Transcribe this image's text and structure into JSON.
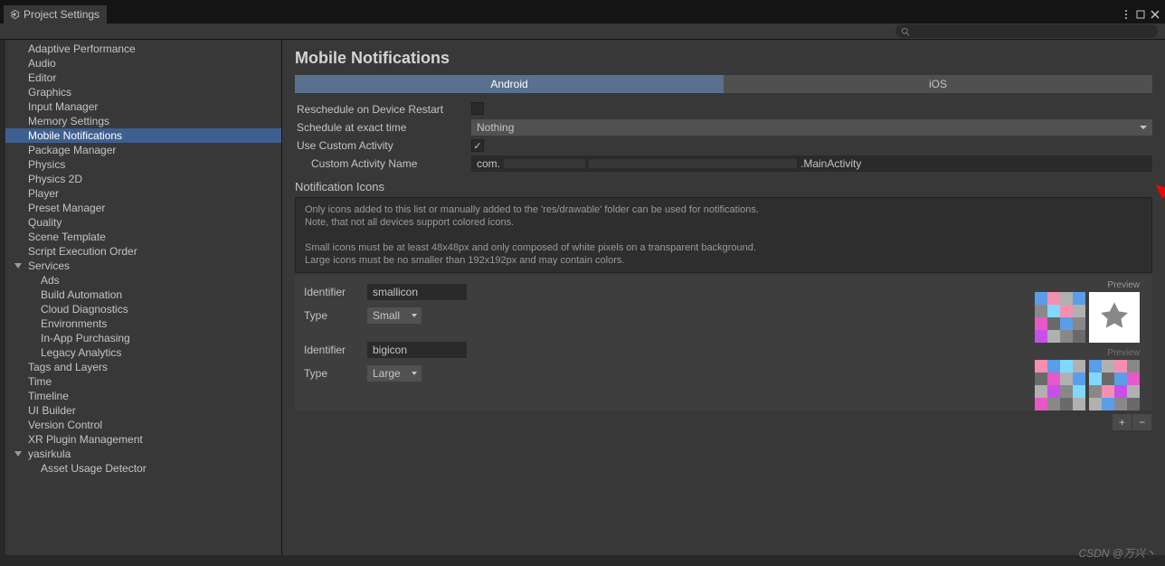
{
  "window": {
    "tab_title": "Project Settings"
  },
  "sidebar": {
    "items": [
      {
        "label": "Adaptive Performance"
      },
      {
        "label": "Audio"
      },
      {
        "label": "Editor"
      },
      {
        "label": "Graphics"
      },
      {
        "label": "Input Manager"
      },
      {
        "label": "Memory Settings"
      },
      {
        "label": "Mobile Notifications",
        "selected": true
      },
      {
        "label": "Package Manager"
      },
      {
        "label": "Physics"
      },
      {
        "label": "Physics 2D"
      },
      {
        "label": "Player"
      },
      {
        "label": "Preset Manager"
      },
      {
        "label": "Quality"
      },
      {
        "label": "Scene Template"
      },
      {
        "label": "Script Execution Order"
      },
      {
        "label": "Services",
        "expandable": true,
        "expanded": true
      },
      {
        "label": "Ads",
        "indent": 1
      },
      {
        "label": "Build Automation",
        "indent": 1
      },
      {
        "label": "Cloud Diagnostics",
        "indent": 1
      },
      {
        "label": "Environments",
        "indent": 1
      },
      {
        "label": "In-App Purchasing",
        "indent": 1
      },
      {
        "label": "Legacy Analytics",
        "indent": 1
      },
      {
        "label": "Tags and Layers"
      },
      {
        "label": "Time"
      },
      {
        "label": "Timeline"
      },
      {
        "label": "UI Builder"
      },
      {
        "label": "Version Control"
      },
      {
        "label": "XR Plugin Management"
      },
      {
        "label": "yasirkula",
        "expandable": true,
        "expanded": true
      },
      {
        "label": "Asset Usage Detector",
        "indent": 1
      }
    ]
  },
  "content": {
    "title": "Mobile Notifications",
    "tabs": {
      "android": "Android",
      "ios": "iOS"
    },
    "fields": {
      "reschedule_label": "Reschedule on Device Restart",
      "reschedule_value": false,
      "schedule_exact_label": "Schedule at exact time",
      "schedule_exact_value": "Nothing",
      "use_custom_label": "Use Custom Activity",
      "use_custom_value": true,
      "custom_activity_label": "Custom Activity Name",
      "custom_activity_value_prefix": "com.",
      "custom_activity_value_suffix": ".MainActivity"
    },
    "notification_icons": {
      "title": "Notification Icons",
      "info_line1": "Only icons added to this list or manually added to the 'res/drawable' folder can be used for notifications.",
      "info_line2": "Note, that not all devices support colored icons.",
      "info_line3": "Small icons must be at least 48x48px and only composed of white pixels on a transparent background.",
      "info_line4": "Large icons must be no smaller than 192x192px and may contain colors.",
      "identifier_label": "Identifier",
      "type_label": "Type",
      "preview_label": "Preview",
      "entries": [
        {
          "identifier": "smallicon",
          "type": "Small"
        },
        {
          "identifier": "bigicon",
          "type": "Large"
        }
      ]
    }
  },
  "watermark": "CSDN @万兴丶"
}
